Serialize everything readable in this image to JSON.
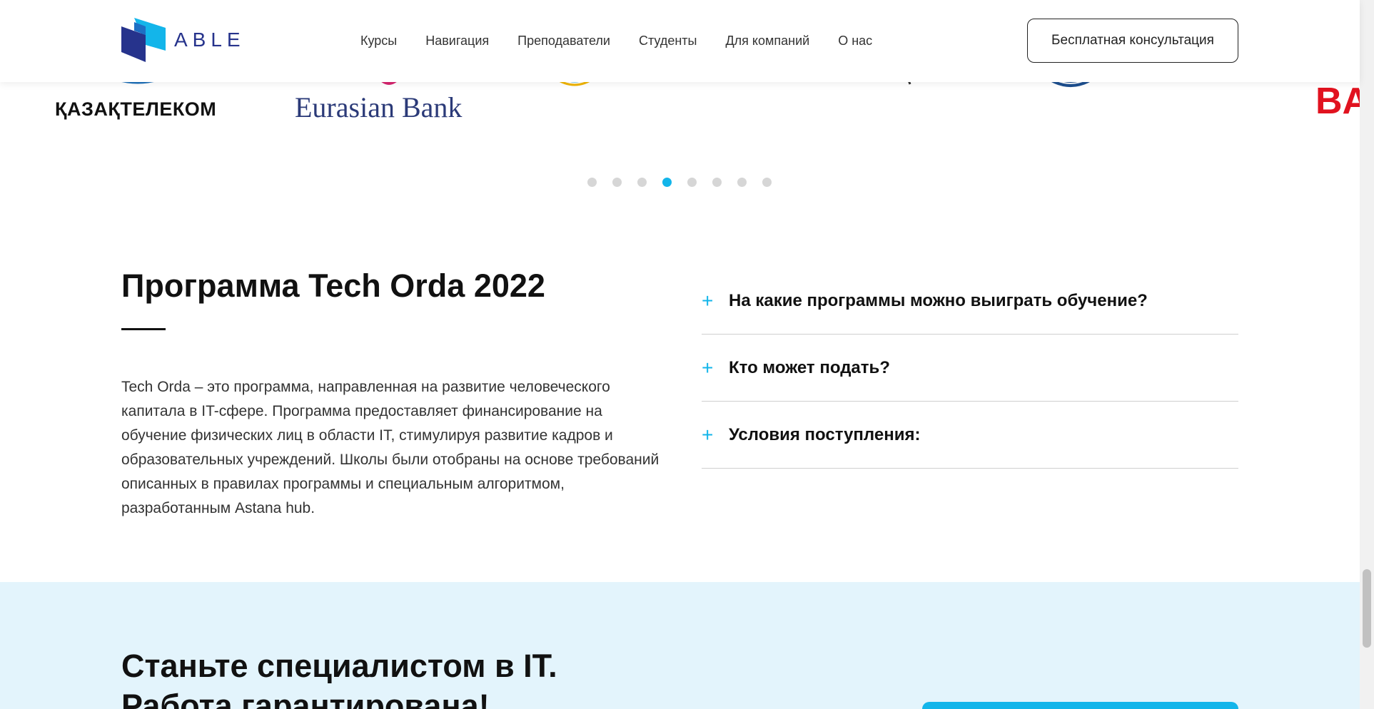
{
  "header": {
    "logo_text": "ABLE",
    "logo_icon": "able-logo-icon",
    "nav": [
      {
        "label": "Курсы"
      },
      {
        "label": "Навигация"
      },
      {
        "label": "Преподаватели"
      },
      {
        "label": "Студенты"
      },
      {
        "label": "Для компаний"
      },
      {
        "label": "О нас"
      }
    ],
    "consult_button": "Бесплатная консультация"
  },
  "partners": {
    "items": [
      {
        "text": "ҚАЗАҚТЕЛЕКОМ"
      },
      {
        "text": "Eurasian Bank"
      },
      {
        "text": "BA"
      }
    ],
    "dots_count": 8,
    "active_dot": 4
  },
  "program": {
    "title": "Программа Tech Orda 2022",
    "description": "Tech Orda – это программа, направленная на развитие человеческого капитала в IT-сфере. Программа предоставляет финансирование на обучение физических лиц в области IT, стимулируя развитие кадров и образовательных учреждений. Школы были отобраны на основе требований описанных в правилах программы и специальным алгоритмом, разработанным Astana hub."
  },
  "faq": [
    {
      "icon": "plus-icon",
      "question": "На какие программы можно выиграть обучение?"
    },
    {
      "icon": "plus-icon",
      "question": "Кто может подать?"
    },
    {
      "icon": "plus-icon",
      "question": "Условия поступления:"
    }
  ],
  "cta": {
    "title_line1": "Станьте специалистом в IT.",
    "title_line2": "Работа гарантирована!"
  },
  "colors": {
    "accent": "#13b5ea",
    "brand_dark": "#26338c",
    "cta_bg": "#e3f4fc"
  }
}
